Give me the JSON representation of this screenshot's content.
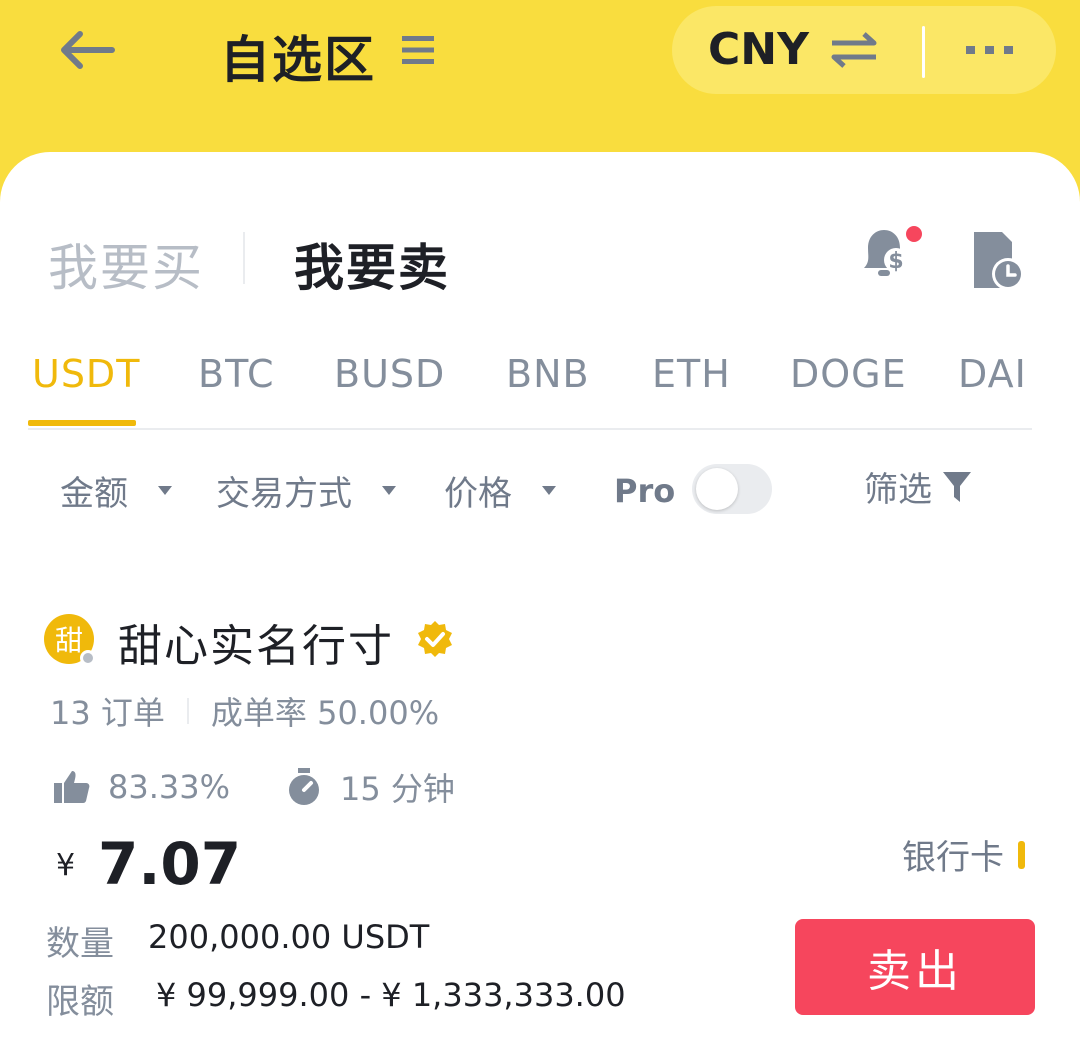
{
  "header": {
    "title": "自选区",
    "currency": "CNY",
    "back_icon": "arrow-left-icon",
    "menu_icon": "hamburger-icon",
    "swap_icon": "swap-arrows-icon",
    "more_icon": "more-dots-icon"
  },
  "trade_tabs": {
    "buy_label": "我要买",
    "sell_label": "我要卖",
    "active": "sell"
  },
  "coin_tabs": {
    "items": [
      "USDT",
      "BTC",
      "BUSD",
      "BNB",
      "ETH",
      "DOGE",
      "DAI"
    ],
    "active": "USDT"
  },
  "filters": {
    "amount_label": "金额",
    "payment_method_label": "交易方式",
    "price_label": "价格",
    "pro_label": "Pro",
    "pro_enabled": false,
    "filter_label": "筛选"
  },
  "listing": {
    "avatar_text": "甜",
    "merchant_name": "甜心实名行寸",
    "verified": true,
    "orders": "13 订单",
    "completion": "成单率 50.00%",
    "positive_rate": "83.33%",
    "pay_time": "15 分钟",
    "price_symbol": "¥",
    "price": "7.07",
    "payment_method": "银行卡",
    "quantity_label": "数量",
    "quantity_value": "200,000.00 USDT",
    "limit_label": "限额",
    "limit_value": "¥ 99,999.00 - ¥ 1,333,333.00",
    "action_label": "卖出"
  },
  "colors": {
    "brand_yellow": "#f9dd3e",
    "accent": "#f0b90b",
    "sell_red": "#f6465d",
    "notification_dot": "#f6465d"
  }
}
